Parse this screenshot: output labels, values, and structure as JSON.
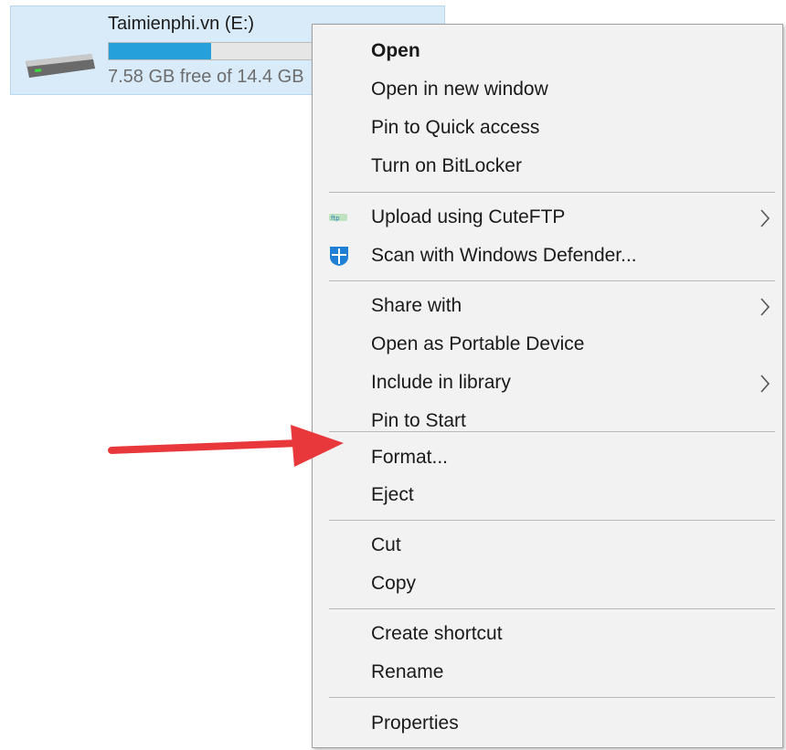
{
  "drive": {
    "name": "Taimienphi.vn (E:)",
    "free_text": "7.58 GB free of 14.4 GB",
    "usage_fraction": 0.47,
    "icon": "hard-drive-icon",
    "bar_color": "#26a0da"
  },
  "context_menu": {
    "items": [
      {
        "label": "Open",
        "bold": true
      },
      {
        "label": "Open in new window"
      },
      {
        "label": "Pin to Quick access"
      },
      {
        "label": "Turn on BitLocker"
      },
      {
        "label": "Upload using CuteFTP",
        "icon": "cuteftp-icon",
        "submenu": true
      },
      {
        "label": "Scan with Windows Defender...",
        "icon": "windows-defender-icon"
      },
      {
        "label": "Share with",
        "submenu": true
      },
      {
        "label": "Open as Portable Device"
      },
      {
        "label": "Include in library",
        "submenu": true
      },
      {
        "label": "Pin to Start"
      },
      {
        "label": "Format..."
      },
      {
        "label": "Eject"
      },
      {
        "label": "Cut"
      },
      {
        "label": "Copy"
      },
      {
        "label": "Create shortcut"
      },
      {
        "label": "Rename"
      },
      {
        "label": "Properties"
      }
    ]
  },
  "annotation": {
    "arrow_color": "#e8383c",
    "points_to": "Format..."
  }
}
